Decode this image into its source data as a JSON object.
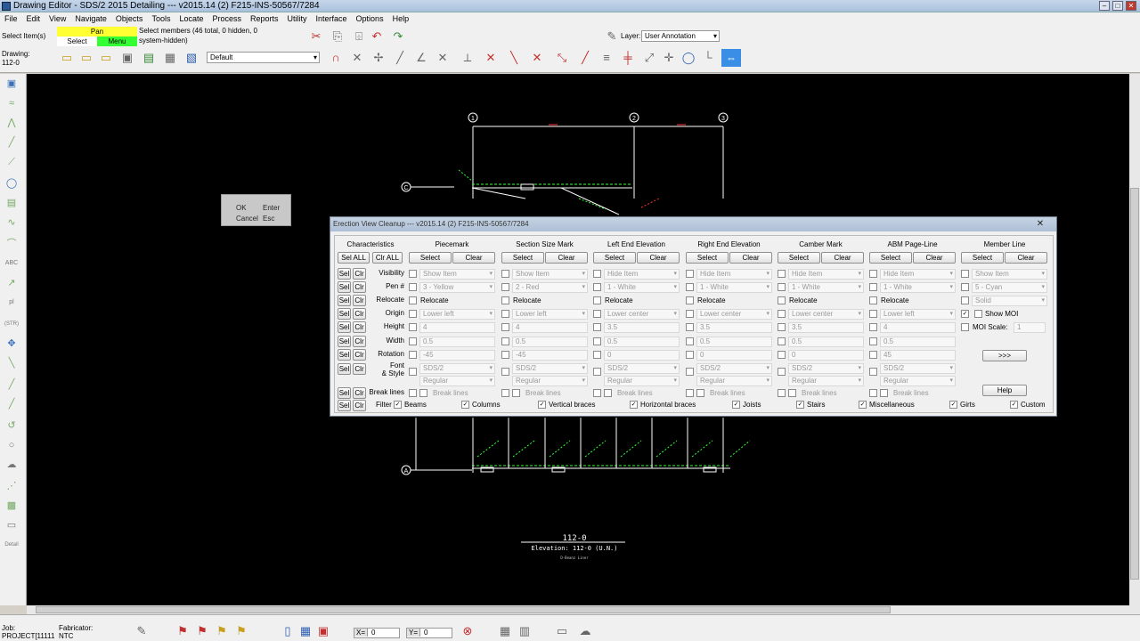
{
  "window": {
    "title": "Drawing Editor - SDS/2 2015 Detailing  --- v2015.14  (2) F215-INS-50567/7284"
  },
  "menu": [
    "File",
    "Edit",
    "View",
    "Navigate",
    "Objects",
    "Tools",
    "Locate",
    "Process",
    "Reports",
    "Utility",
    "Interface",
    "Options",
    "Help"
  ],
  "toolbar": {
    "select_items_label": "Select Item(s)",
    "pan_label": "Pan",
    "select_label": "Select",
    "menu_label": "Menu",
    "status_line1": "Select members (46 total, 0 hidden, 0",
    "status_line2": "system-hidden)",
    "drawing_label": "Drawing:",
    "drawing_value": "112-0",
    "view_combo": "Default",
    "layer_label": "Layer:",
    "layer_value": "User Annotation"
  },
  "context_menu": {
    "ok": "OK",
    "ok_key": "Enter",
    "cancel": "Cancel",
    "cancel_key": "Esc"
  },
  "canvas": {
    "grid_labels": [
      "1",
      "2",
      "3",
      "C",
      "A"
    ],
    "title_number": "112-0",
    "title_text": "Elevation: 112-0 (U.N.)",
    "title_sub": "D-Beanz Liner",
    "colors": {
      "background": "#000000",
      "structure": "#ffffff",
      "annotation": "#33ff33",
      "dimension": "#ff3333"
    }
  },
  "dialog": {
    "title": "Erection View Cleanup  --- v2015.14  (2) F215-INS-50567/7284",
    "close": "✕",
    "characteristics": {
      "header": "Characteristics",
      "sel_all": "Sel ALL",
      "clr_all": "Clr ALL",
      "sel": "Sel",
      "clr": "Clr",
      "rows": [
        "Visibility",
        "Pen #",
        "Relocate",
        "Origin",
        "Height",
        "Width",
        "Rotation",
        "Font",
        "& Style",
        "Break lines"
      ]
    },
    "columns": [
      {
        "header": "Piecemark",
        "select": "Select",
        "clear": "Clear",
        "visibility": "Show Item",
        "pen": "3 - Yellow",
        "relocate": "Relocate",
        "origin": "Lower left",
        "height": "4",
        "width": "0.5",
        "rotation": "-45",
        "font": "SDS/2",
        "style": "Regular",
        "break": "Break lines"
      },
      {
        "header": "Section Size Mark",
        "select": "Select",
        "clear": "Clear",
        "visibility": "Show Item",
        "pen": "2 - Red",
        "relocate": "Relocate",
        "origin": "Lower left",
        "height": "4",
        "width": "0.5",
        "rotation": "-45",
        "font": "SDS/2",
        "style": "Regular",
        "break": "Break lines"
      },
      {
        "header": "Left End Elevation",
        "select": "Select",
        "clear": "Clear",
        "visibility": "Hide Item",
        "pen": "1 - White",
        "relocate": "Relocate",
        "origin": "Lower center",
        "height": "3.5",
        "width": "0.5",
        "rotation": "0",
        "font": "SDS/2",
        "style": "Regular",
        "break": "Break lines"
      },
      {
        "header": "Right End Elevation",
        "select": "Select",
        "clear": "Clear",
        "visibility": "Hide Item",
        "pen": "1 - White",
        "relocate": "Relocate",
        "origin": "Lower center",
        "height": "3.5",
        "width": "0.5",
        "rotation": "0",
        "font": "SDS/2",
        "style": "Regular",
        "break": "Break lines"
      },
      {
        "header": "Camber Mark",
        "select": "Select",
        "clear": "Clear",
        "visibility": "Hide Item",
        "pen": "1 - White",
        "relocate": "Relocate",
        "origin": "Lower center",
        "height": "3.5",
        "width": "0.5",
        "rotation": "0",
        "font": "SDS/2",
        "style": "Regular",
        "break": "Break lines"
      },
      {
        "header": "ABM Page-Line",
        "select": "Select",
        "clear": "Clear",
        "visibility": "Hide Item",
        "pen": "1 - White",
        "relocate": "Relocate",
        "origin": "Lower left",
        "height": "4",
        "width": "0.5",
        "rotation": "45",
        "font": "SDS/2",
        "style": "Regular",
        "break": "Break lines"
      }
    ],
    "member_line": {
      "header": "Member Line",
      "select": "Select",
      "clear": "Clear",
      "visibility": "Show Item",
      "pen": "5 - Cyan",
      "line_style": "Solid",
      "show_moi": "Show MOI",
      "moi_scale": "MOI Scale:",
      "moi_scale_value": "1",
      "more": ">>>",
      "help": "Help"
    },
    "filter": {
      "label": "Filter",
      "items": [
        "Beams",
        "Columns",
        "Vertical braces",
        "Horizontal braces",
        "Joists",
        "Stairs",
        "Miscellaneous",
        "Girts",
        "Custom"
      ]
    }
  },
  "statusbar": {
    "job_label": "Job:",
    "job_value": "PROJECT[11111",
    "fabricator_label": "Fabricator:",
    "fabricator_value": "NTC",
    "x_label": "X=",
    "x_value": "0",
    "y_label": "Y=",
    "y_value": "0"
  }
}
